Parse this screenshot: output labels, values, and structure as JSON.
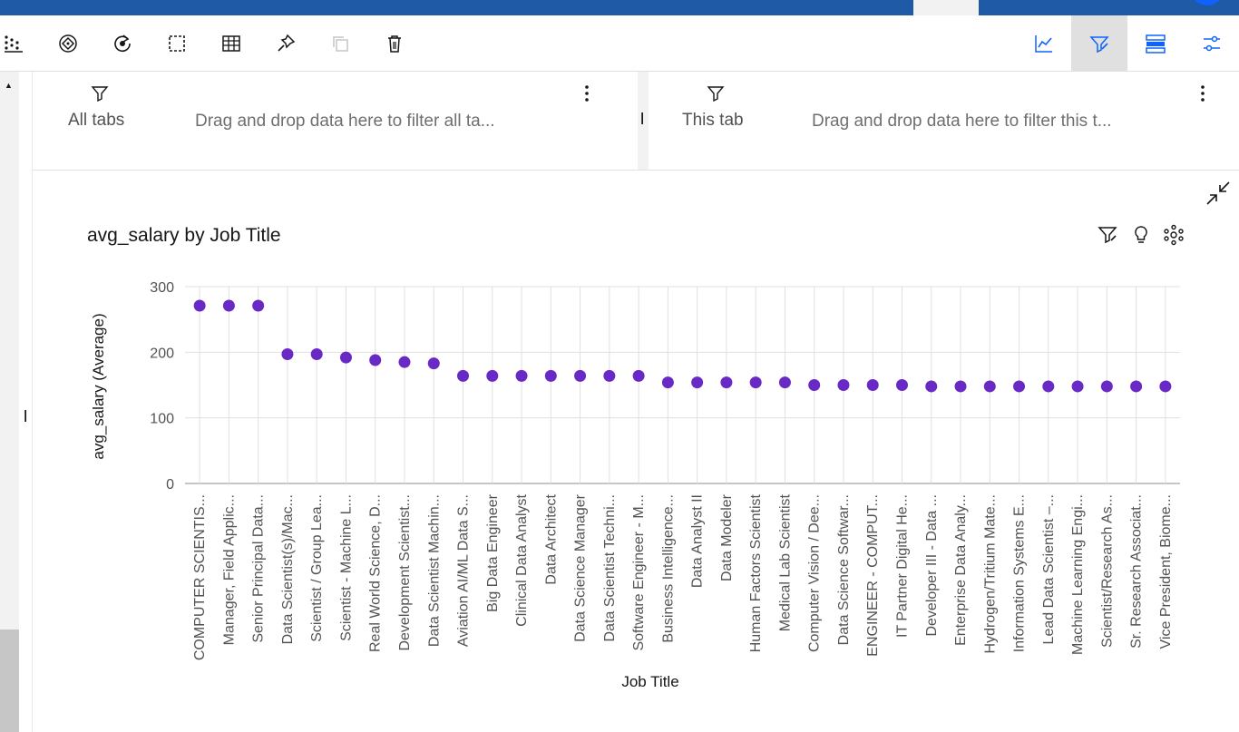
{
  "toolbar": {
    "left_icons": [
      "scatter-grid-icon",
      "target-diamond-icon",
      "refresh-icon",
      "select-area-icon",
      "table-icon",
      "pin-icon",
      "copy-icon",
      "trash-icon"
    ],
    "right_icons": [
      "line-chart-icon",
      "filter-edit-icon",
      "stacked-panels-icon",
      "sliders-icon"
    ]
  },
  "filters": {
    "all_tabs": {
      "label": "All tabs",
      "placeholder": "Drag and drop data here to filter all ta..."
    },
    "this_tab": {
      "label": "This tab",
      "placeholder": "Drag and drop data here to filter this t..."
    }
  },
  "colors": {
    "accent": "#1f5aa6",
    "point": "#6929c4",
    "grid": "#e0e0e0"
  },
  "chart_data": {
    "type": "scatter",
    "title": "avg_salary by Job Title",
    "xlabel": "Job Title",
    "ylabel": "avg_salary (Average)",
    "ylim": [
      0,
      300
    ],
    "yticks": [
      0,
      100,
      200,
      300
    ],
    "grid": true,
    "categories": [
      "COMPUTER SCIENTIS...",
      "Manager, Field Applic...",
      "Senior Principal Data...",
      "Data Scientist(s)/Mac...",
      "Scientist / Group Lea...",
      "Scientist - Machine L...",
      "Real World Science, D...",
      "Development Scientist...",
      "Data Scientist Machin...",
      "Aviation AI/ML Data S...",
      "Big Data Engineer",
      "Clinical Data Analyst",
      "Data Architect",
      "Data Science Manager",
      "Data Scientist Techni...",
      "Software Engineer - M...",
      "Business Intelligence...",
      "Data Analyst II",
      "Data Modeler",
      "Human Factors Scientist",
      "Medical Lab Scientist",
      "Computer Vision / Dee...",
      "Data Science Softwar...",
      "ENGINEER - COMPUT...",
      "IT Partner Digital He...",
      "Developer III - Data ...",
      "Enterprise Data Analy...",
      "Hydrogen/Tritium Mate...",
      "Information Systems E...",
      "Lead Data Scientist –...",
      "Machine Learning Engi...",
      "Scientist/Research As...",
      "Sr. Research Associat...",
      "Vice President, Biome..."
    ],
    "values": [
      271,
      271,
      271,
      197,
      197,
      192,
      188,
      185,
      183,
      164,
      164,
      164,
      164,
      164,
      164,
      164,
      154,
      154,
      154,
      154,
      154,
      150,
      150,
      150,
      150,
      148,
      148,
      148,
      148,
      148,
      148,
      148,
      148,
      148
    ]
  }
}
